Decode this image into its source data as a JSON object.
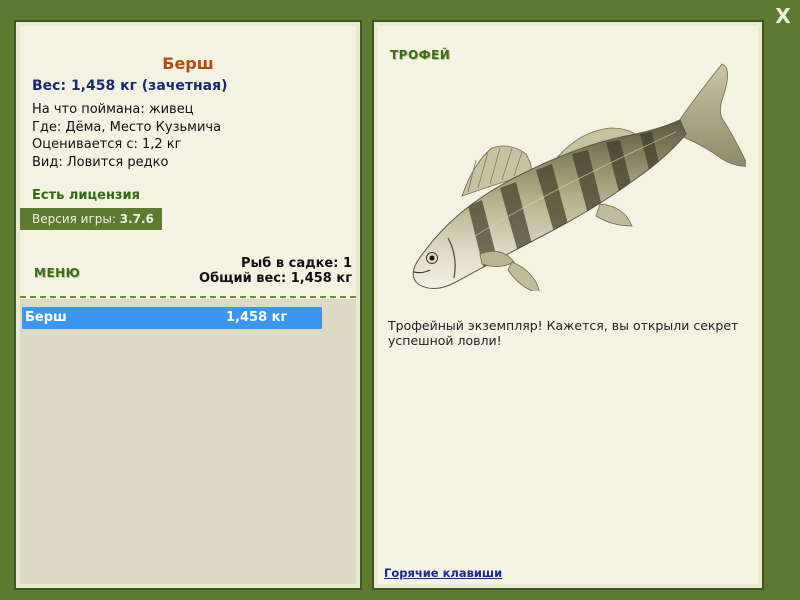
{
  "close_label": "X",
  "fish": {
    "name": "Берш",
    "weight_line": "Вес: 1,458 кг (зачетная)",
    "info": [
      "На что поймана: живец",
      "Где: Дёма, Место Кузьмича",
      "Оценивается с: 1,2 кг",
      "Вид: Ловится редко"
    ]
  },
  "license_text": "Есть лицензия",
  "version": {
    "label": "Версия игры: ",
    "value": "3.7.6"
  },
  "menu_label": "МЕНЮ",
  "keepnet": {
    "count_line": "Рыб в садке: 1",
    "total_line": "Общий вес: 1,458 кг",
    "items": [
      {
        "name": "Берш",
        "weight": "1,458 кг"
      }
    ]
  },
  "trophy": {
    "title": "ТРОФЕЙ",
    "description": "Трофейный экземпляр! Кажется, вы открыли секрет успешной ловли!",
    "image_icon": "zander-fish-image"
  },
  "hotkeys_label": "Горячие клавиши",
  "colors": {
    "background": "#5c7a30",
    "panel": "#f4f2e2",
    "list_area": "#dcdac4",
    "selection": "#3a96f2",
    "fish_name": "#b84a10",
    "weight": "#1a2a6e",
    "green_text": "#3d6b1a"
  }
}
